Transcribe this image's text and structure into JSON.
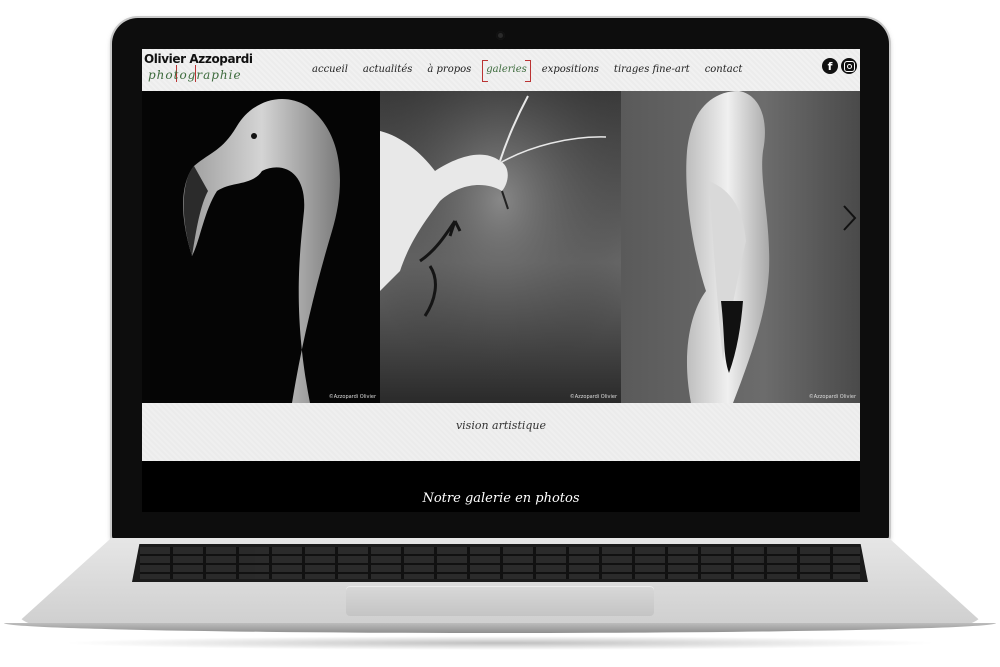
{
  "site": {
    "logo": {
      "name": "Olivier Azzopardi",
      "sub": "photographie"
    },
    "nav": [
      {
        "label": "accueil",
        "active": false
      },
      {
        "label": "actualités",
        "active": false
      },
      {
        "label": "à propos",
        "active": false
      },
      {
        "label": "galeries",
        "active": true
      },
      {
        "label": "expositions",
        "active": false
      },
      {
        "label": "tirages fine-art",
        "active": false
      },
      {
        "label": "contact",
        "active": false
      }
    ],
    "social": {
      "facebook_glyph": "f",
      "facebook_icon": "facebook-icon",
      "instagram_icon": "instagram-icon"
    },
    "gallery": {
      "photos": [
        {
          "subject": "flamingo-head",
          "credit": "©Azzopardi Olivier"
        },
        {
          "subject": "egret-flight",
          "credit": "©Azzopardi Olivier"
        },
        {
          "subject": "flamingo-closeup",
          "credit": "©Azzopardi Olivier"
        }
      ],
      "next_icon": "chevron-right-icon"
    },
    "tagline": "vision artistique",
    "section_title": "Notre galerie en photos"
  },
  "colors": {
    "accent_green": "#3d6b3d",
    "bracket_red": "#bb3333",
    "header_bg": "#eeeeee"
  }
}
